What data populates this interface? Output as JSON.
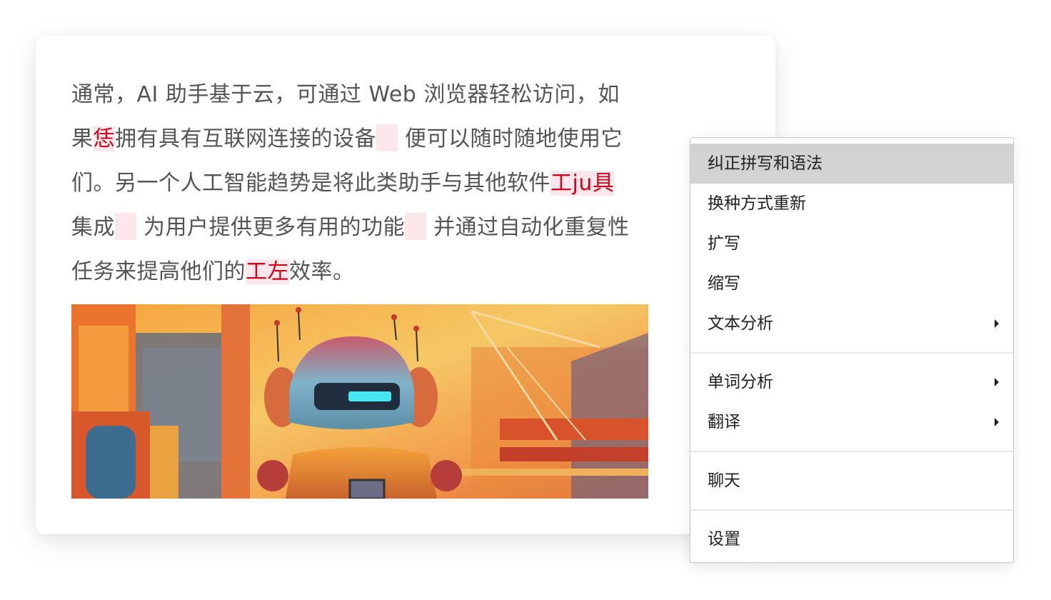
{
  "document": {
    "lines": [
      [
        {
          "text": "通常，AI 助手基于云，可通过 Web 浏览器轻松访问，如",
          "type": "normal"
        }
      ],
      [
        {
          "text": "果",
          "type": "normal"
        },
        {
          "text": "恁",
          "type": "error"
        },
        {
          "text": "拥有具有互联网连接的设备",
          "type": "normal"
        },
        {
          "text": "",
          "type": "gap"
        },
        {
          "text": " 便可以随时随地使用它",
          "type": "normal"
        }
      ],
      [
        {
          "text": "们。另一个人工智能趋势是将此类助手与其他软件",
          "type": "normal"
        },
        {
          "text": "工ju具",
          "type": "error"
        }
      ],
      [
        {
          "text": "集成",
          "type": "normal"
        },
        {
          "text": "",
          "type": "gap"
        },
        {
          "text": " 为用户提供更多有用的功能",
          "type": "normal"
        },
        {
          "text": "",
          "type": "gap"
        },
        {
          "text": " 并通过自动化重复性",
          "type": "normal"
        }
      ],
      [
        {
          "text": "任务来提高他们的",
          "type": "normal"
        },
        {
          "text": "工左",
          "type": "error"
        },
        {
          "text": "效率。",
          "type": "normal"
        }
      ]
    ]
  },
  "context_menu": {
    "groups": [
      [
        {
          "label": "纠正拼写和语法",
          "highlighted": true,
          "submenu": false,
          "name": "menu-item-correct-spelling-grammar"
        },
        {
          "label": "换种方式重新",
          "highlighted": false,
          "submenu": false,
          "name": "menu-item-rephrase"
        },
        {
          "label": "扩写",
          "highlighted": false,
          "submenu": false,
          "name": "menu-item-expand"
        },
        {
          "label": "缩写",
          "highlighted": false,
          "submenu": false,
          "name": "menu-item-shorten"
        },
        {
          "label": "文本分析",
          "highlighted": false,
          "submenu": true,
          "name": "menu-item-text-analysis"
        }
      ],
      [
        {
          "label": "单词分析",
          "highlighted": false,
          "submenu": true,
          "name": "menu-item-word-analysis"
        },
        {
          "label": "翻译",
          "highlighted": false,
          "submenu": true,
          "name": "menu-item-translate"
        }
      ],
      [
        {
          "label": "聊天",
          "highlighted": false,
          "submenu": false,
          "name": "menu-item-chat"
        }
      ],
      [
        {
          "label": "设置",
          "highlighted": false,
          "submenu": false,
          "name": "menu-item-settings"
        }
      ]
    ]
  },
  "colors": {
    "error_text": "#d0021b",
    "error_background": "#fde7ea",
    "body_text": "#555555",
    "menu_highlight": "#d2d2d2"
  },
  "icons": {
    "submenu_indicator": "chevron-right-icon"
  }
}
